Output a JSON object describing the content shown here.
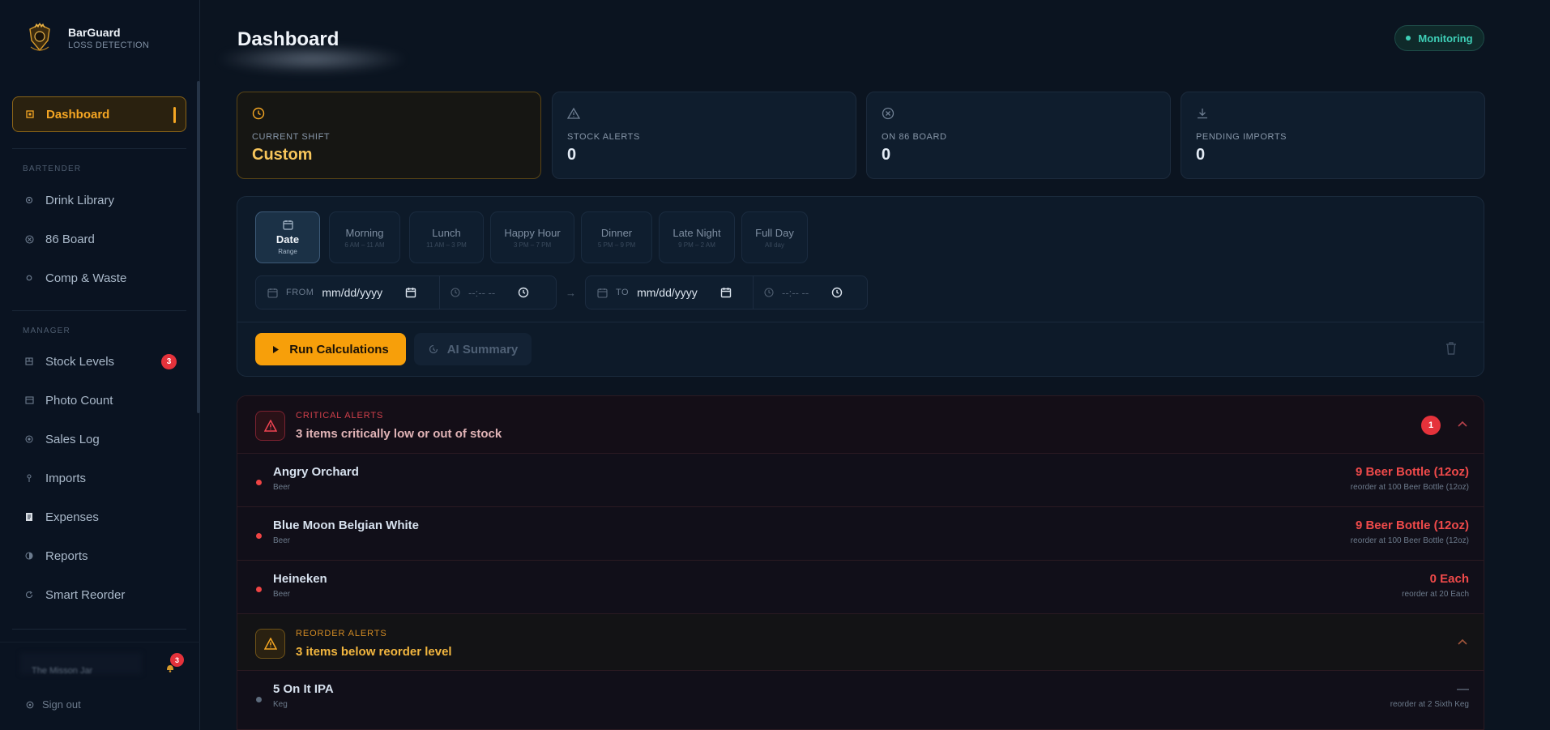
{
  "brand": {
    "name": "BarGuard",
    "subtitle": "LOSS DETECTION"
  },
  "sidebar": {
    "items": [
      {
        "label": "Dashboard",
        "icon": "square-dot-icon",
        "active": true
      },
      {
        "label": "Drink Library",
        "icon": "settings-dot-icon"
      },
      {
        "label": "86 Board",
        "icon": "circle-x-icon"
      },
      {
        "label": "Comp & Waste",
        "icon": "ring-icon"
      },
      {
        "label": "Stock Levels",
        "icon": "box-icon",
        "badge": "3"
      },
      {
        "label": "Photo Count",
        "icon": "image-icon"
      },
      {
        "label": "Sales Log",
        "icon": "target-icon"
      },
      {
        "label": "Imports",
        "icon": "import-icon"
      },
      {
        "label": "Expenses",
        "icon": "receipt-icon"
      },
      {
        "label": "Reports",
        "icon": "half-circle-icon"
      },
      {
        "label": "Smart Reorder",
        "icon": "refresh-icon"
      }
    ],
    "sections": {
      "bartender": "BARTENDER",
      "manager": "MANAGER"
    },
    "user": {
      "name": "The Misson Jar",
      "notifications": "3"
    },
    "signout": "Sign out"
  },
  "header": {
    "title": "Dashboard",
    "status": "Monitoring"
  },
  "stats": [
    {
      "label": "CURRENT SHIFT",
      "value": "Custom",
      "icon": "clock-icon"
    },
    {
      "label": "STOCK ALERTS",
      "value": "0",
      "icon": "warning-icon"
    },
    {
      "label": "ON 86 BOARD",
      "value": "0",
      "icon": "circle-x-icon"
    },
    {
      "label": "PENDING IMPORTS",
      "value": "0",
      "icon": "download-icon"
    }
  ],
  "shifts": [
    {
      "name": "Date",
      "time": "Range",
      "active": true
    },
    {
      "name": "Morning",
      "time": "6 AM – 11 AM"
    },
    {
      "name": "Lunch",
      "time": "11 AM – 3 PM"
    },
    {
      "name": "Happy Hour",
      "time": "3 PM – 7 PM"
    },
    {
      "name": "Dinner",
      "time": "5 PM – 9 PM"
    },
    {
      "name": "Late Night",
      "time": "9 PM – 2 AM"
    },
    {
      "name": "Full Day",
      "time": "All day"
    }
  ],
  "range": {
    "from_label": "FROM",
    "from_date": "mm/dd/yyyy",
    "from_time": "--:-- --",
    "to_label": "TO",
    "to_date": "mm/dd/yyyy",
    "to_time": "--:-- --"
  },
  "actions": {
    "run": "Run Calculations",
    "ai": "AI Summary"
  },
  "critical": {
    "kicker": "CRITICAL ALERTS",
    "subtitle": "3 items critically low or out of stock",
    "count": "1",
    "rows": [
      {
        "name": "Angry Orchard",
        "category": "Beer",
        "qty": "9 Beer Bottle (12oz)",
        "reorder": "reorder at 100 Beer Bottle (12oz)"
      },
      {
        "name": "Blue Moon Belgian White",
        "category": "Beer",
        "qty": "9 Beer Bottle (12oz)",
        "reorder": "reorder at 100 Beer Bottle (12oz)"
      },
      {
        "name": "Heineken",
        "category": "Beer",
        "qty": "0 Each",
        "reorder": "reorder at 20 Each"
      }
    ]
  },
  "reorder": {
    "kicker": "REORDER ALERTS",
    "subtitle": "3 items below reorder level",
    "rows": [
      {
        "name": "5 On It IPA",
        "category": "Keg",
        "qty": "—",
        "reorder": "reorder at 2 Sixth Keg"
      }
    ]
  },
  "colors": {
    "accent": "#f79f0a",
    "critical": "#ef4444",
    "teal": "#3ecfb7"
  }
}
